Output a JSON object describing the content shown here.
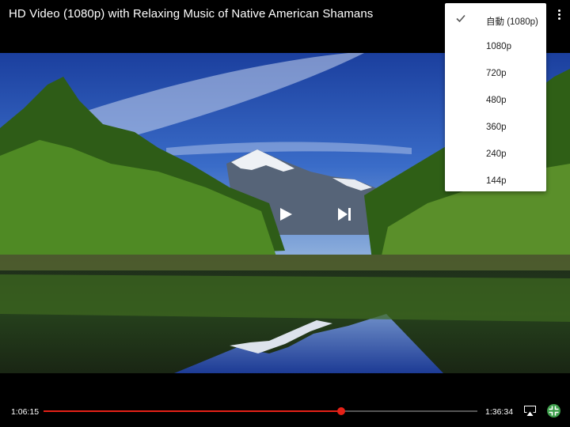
{
  "header": {
    "title": "HD Video (1080p) with Relaxing Music of Native American Shamans"
  },
  "icons": {
    "more": "more-vert-icon",
    "play": "play-icon",
    "next": "skip-next-icon",
    "cast": "airplay-icon",
    "fullscreen": "exit-fullscreen-icon",
    "check": "check-icon"
  },
  "quality_menu": {
    "selected_index": 0,
    "options": [
      {
        "label": "自動 (1080p)"
      },
      {
        "label": "1080p"
      },
      {
        "label": "720p"
      },
      {
        "label": "480p"
      },
      {
        "label": "360p"
      },
      {
        "label": "240p"
      },
      {
        "label": "144p"
      }
    ]
  },
  "player": {
    "current_time": "1:06:15",
    "duration": "1:36:34",
    "progress": 0.686
  },
  "colors": {
    "accent": "#e62117",
    "menu_bg": "#ffffff",
    "background": "#000000"
  }
}
